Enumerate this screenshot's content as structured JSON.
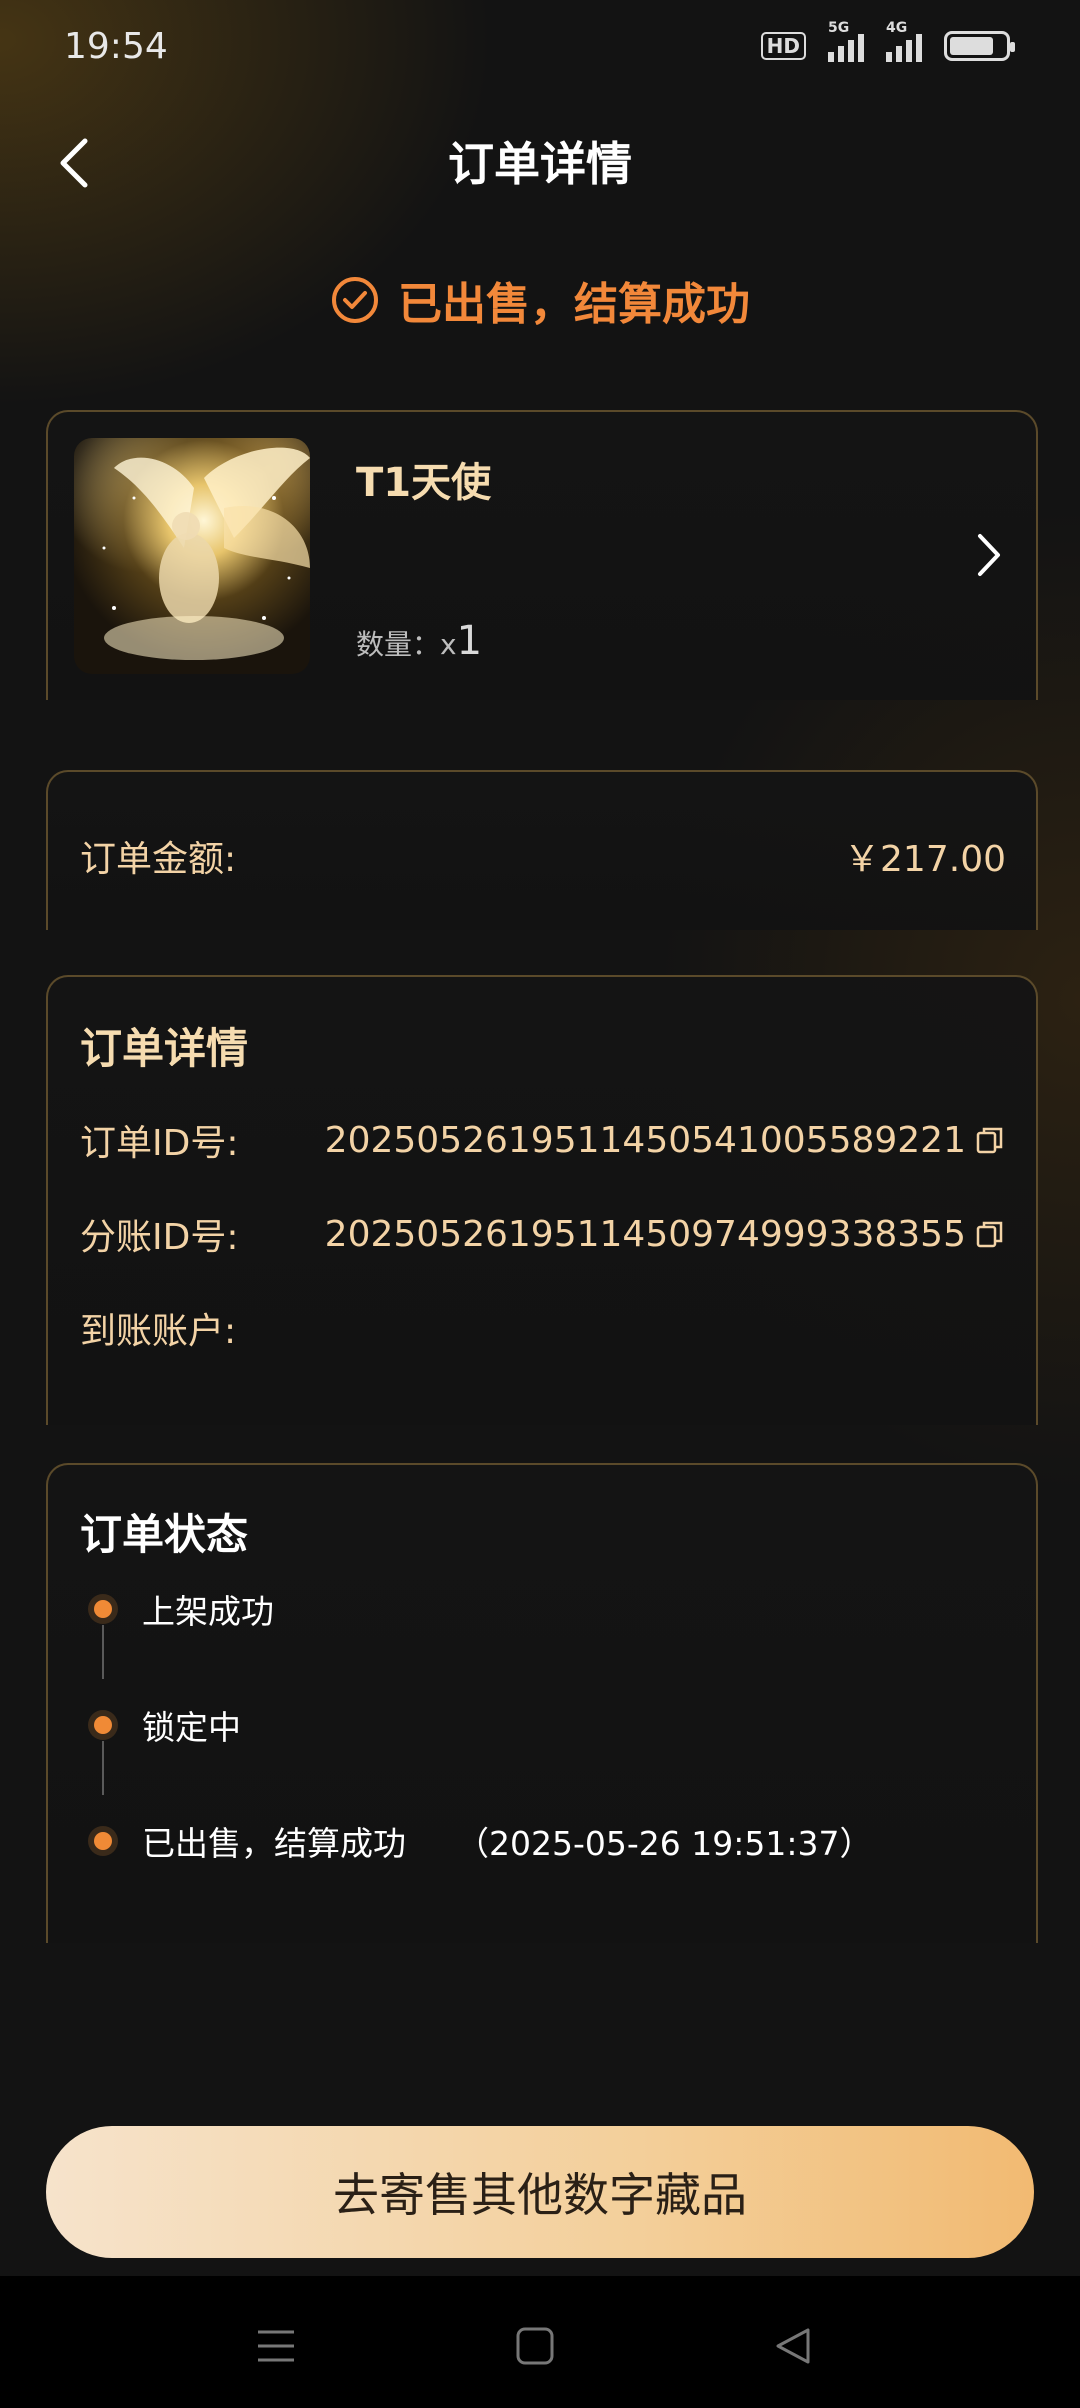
{
  "status_bar": {
    "time": "19:54",
    "hd": "HD",
    "sim1_tag": "5G",
    "sim2_tag": "4G"
  },
  "header": {
    "title": "订单详情"
  },
  "banner": {
    "text": "已出售，结算成功"
  },
  "product": {
    "name": "T1天使",
    "quantity_label": "数量：x",
    "quantity_value": "1"
  },
  "amount": {
    "label": "订单金额:",
    "value": "￥217.00"
  },
  "detail": {
    "title": "订单详情",
    "rows": [
      {
        "label": "订单ID号:",
        "value": "2025052619511450541005589221"
      },
      {
        "label": "分账ID号:",
        "value": "2025052619511450974999338355"
      },
      {
        "label": "到账账户:",
        "value": ""
      }
    ]
  },
  "order_status": {
    "title": "订单状态",
    "steps": [
      {
        "text": "上架成功",
        "time": ""
      },
      {
        "text": "锁定中",
        "time": ""
      },
      {
        "text": "已出售，结算成功",
        "time": "（2025-05-26 19:51:37）"
      }
    ]
  },
  "cta": {
    "label": "去寄售其他数字藏品"
  },
  "colors": {
    "accent_orange": "#f2883a",
    "gold_text": "#f3d3a6",
    "card_border": "#5b4a2a"
  }
}
